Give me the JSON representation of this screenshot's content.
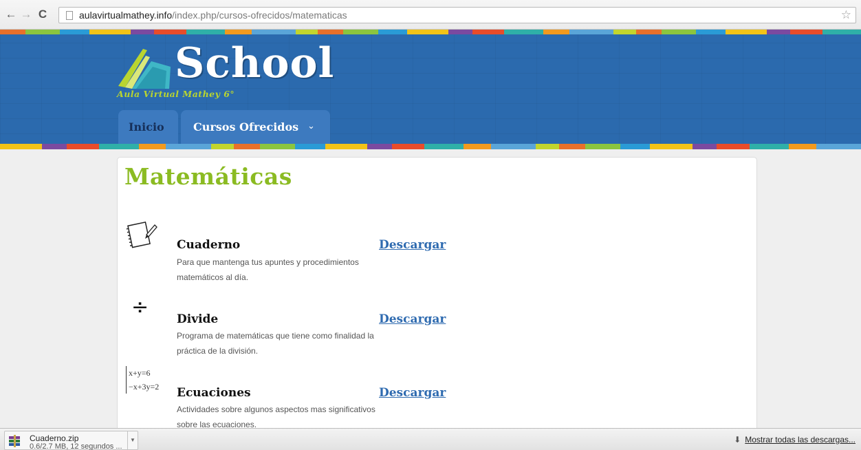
{
  "browser": {
    "url_host": "aulavirtualmathey.info",
    "url_path": "/index.php/cursos-ofrecidos/matematicas"
  },
  "site": {
    "logo_title": "School",
    "logo_subtitle": "Aula Virtual Mathey 6°",
    "nav": {
      "inicio": "Inicio",
      "cursos": "Cursos Ofrecidos",
      "cursos_chevron": "⌄"
    }
  },
  "page": {
    "title": "Matemáticas",
    "items": [
      {
        "icon": "notebook-icon",
        "title": "Cuaderno",
        "desc_line1": "Para que mantenga tus apuntes y procedimientos",
        "desc_line2": "matemáticos al día.",
        "link": "Descargar"
      },
      {
        "icon": "divide-icon",
        "icon_text": "÷",
        "title": "Divide",
        "desc_line1": "Programa de matemáticas que tiene como finalidad la",
        "desc_line2": "práctica de la división.",
        "link": "Descargar"
      },
      {
        "icon": "equation-system-icon",
        "eq_line1": "x+y=6",
        "eq_line2": "−x+3y=2",
        "title": "Ecuaciones",
        "desc_line1": "Actividades sobre algunos aspectos mas significativos",
        "desc_line2": "sobre las ecuaciones.",
        "link": "Descargar"
      }
    ]
  },
  "downloads": {
    "file_name": "Cuaderno.zip",
    "status": "0.6/2.7 MB, 12 segundos ...",
    "show_all": "Mostrar todas las descargas..."
  },
  "colors": {
    "header_blue": "#2b6aae",
    "title_green": "#8bbb22",
    "link_blue": "#2f6bb0"
  }
}
